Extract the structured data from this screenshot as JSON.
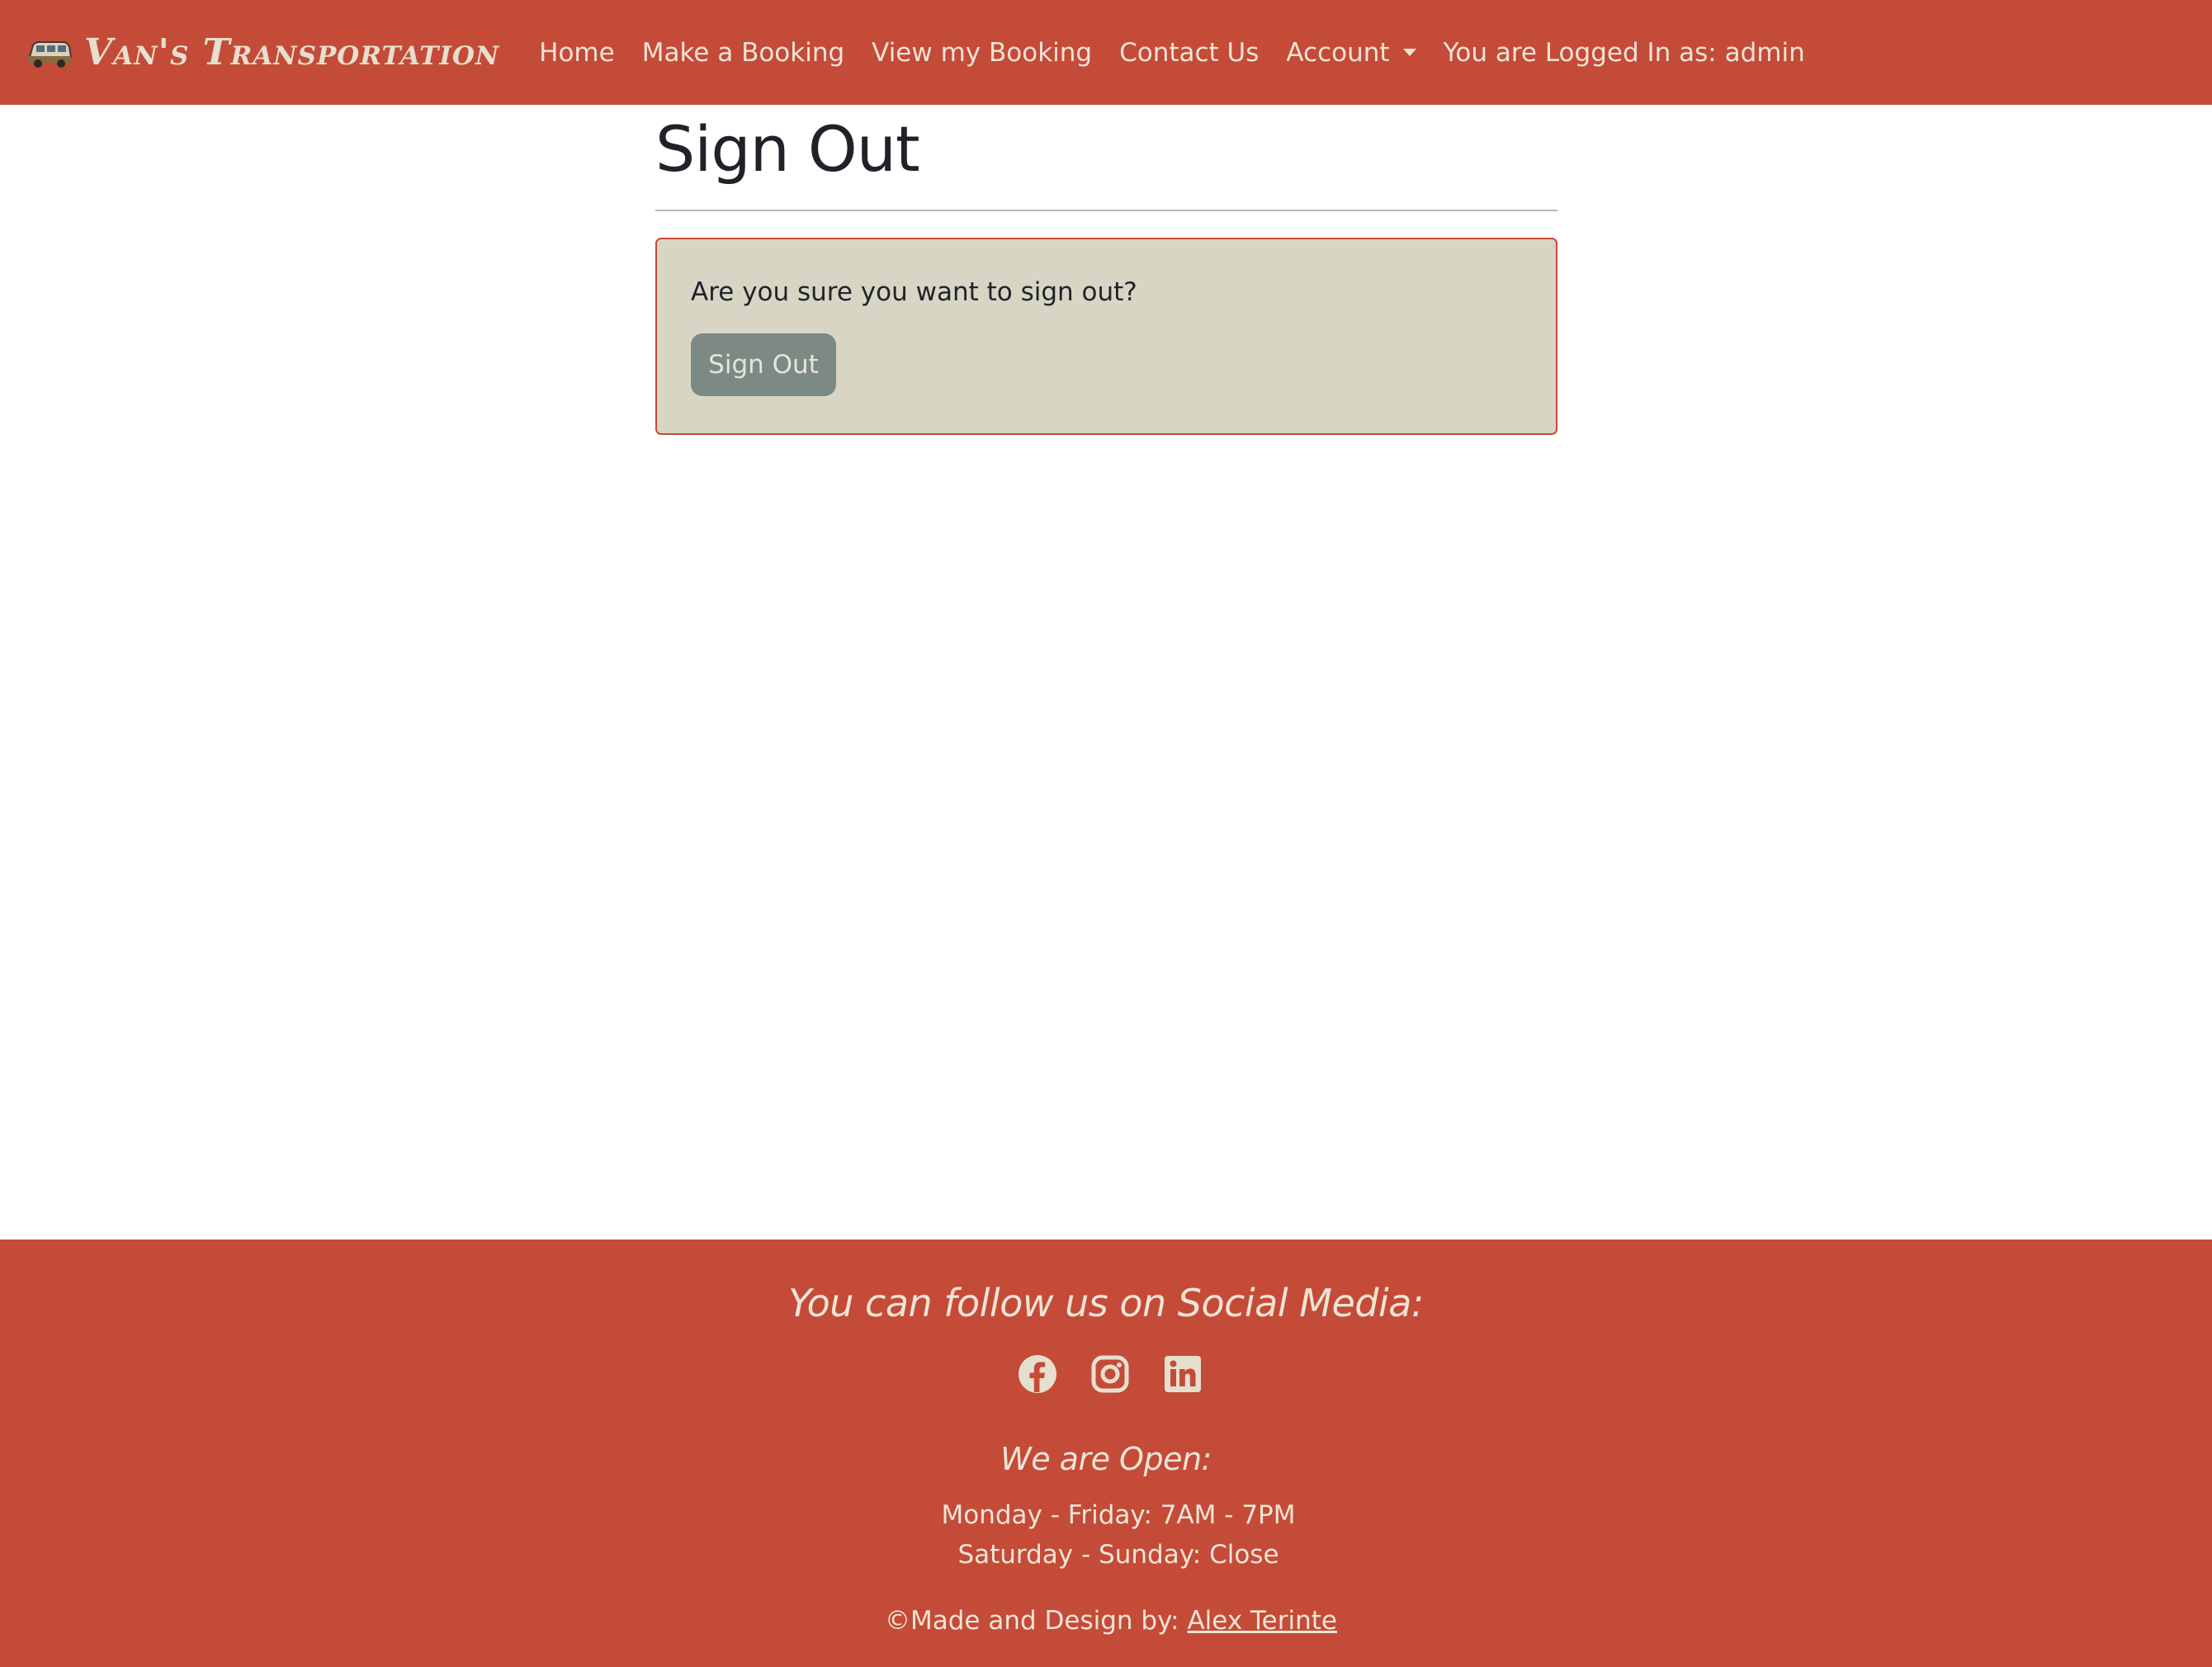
{
  "navbar": {
    "brand_text": "Van's Transportation",
    "links": [
      {
        "label": "Home"
      },
      {
        "label": "Make a Booking"
      },
      {
        "label": "View my Booking"
      },
      {
        "label": "Contact Us"
      },
      {
        "label": "Account"
      }
    ],
    "status_text": "You are Logged In as: admin"
  },
  "main": {
    "title": "Sign Out",
    "card": {
      "message": "Are you sure you want to sign out?",
      "button_label": "Sign Out"
    }
  },
  "footer": {
    "follow_heading": "You can follow us on Social Media:",
    "social_icons": [
      "facebook-icon",
      "instagram-icon",
      "linkedin-icon"
    ],
    "open_heading": "We are Open:",
    "hours": [
      "Monday - Friday: 7AM - 7PM",
      "Saturday - Sunday: Close"
    ],
    "credit_prefix": "©Made and Design by: ",
    "credit_link": "Alex Terinte"
  },
  "colors": {
    "primary": "#c44b38",
    "card_bg": "#d8d5c5",
    "button_bg": "#7c8985",
    "text_light": "#eee4d6"
  }
}
